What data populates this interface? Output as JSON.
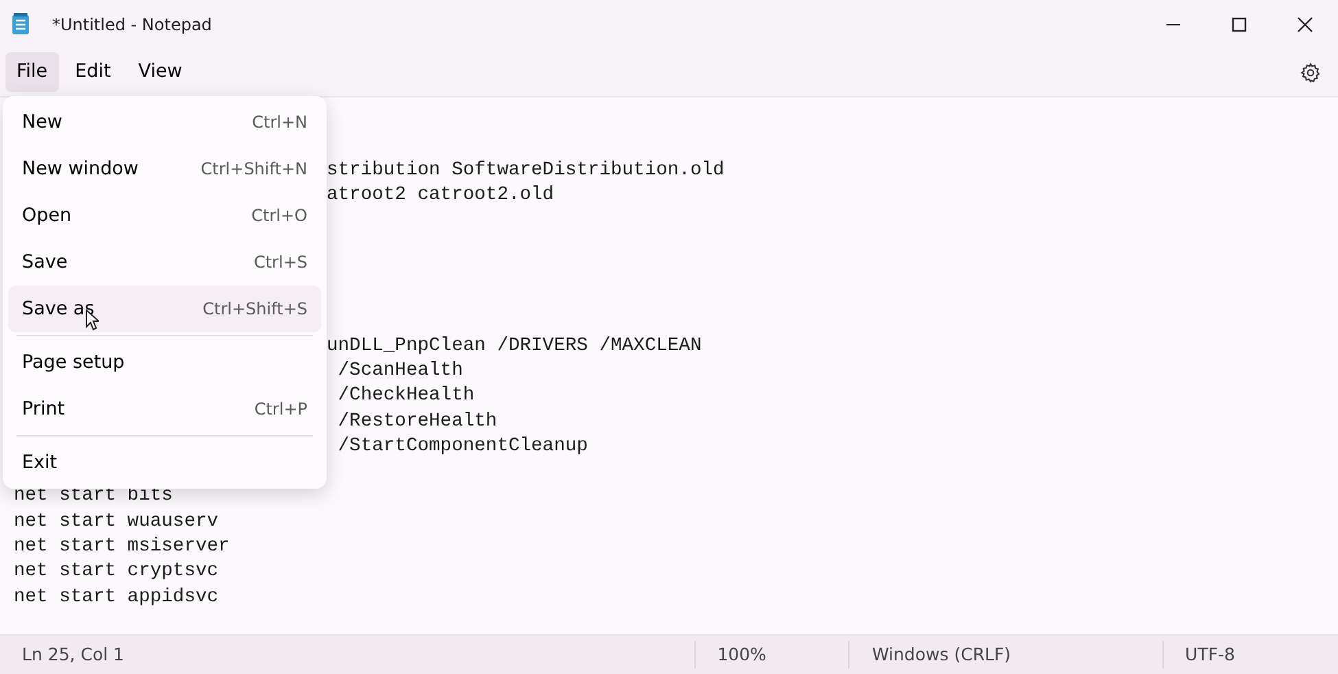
{
  "window": {
    "title": "*Untitled - Notepad"
  },
  "menu_bar": [
    {
      "label": "File",
      "selected": true
    },
    {
      "label": "Edit",
      "selected": false
    },
    {
      "label": "View",
      "selected": false
    }
  ],
  "file_menu": [
    {
      "items": [
        {
          "label": "New",
          "shortcut": "Ctrl+N",
          "hovered": false
        },
        {
          "label": "New window",
          "shortcut": "Ctrl+Shift+N",
          "hovered": false
        },
        {
          "label": "Open",
          "shortcut": "Ctrl+O",
          "hovered": false
        },
        {
          "label": "Save",
          "shortcut": "Ctrl+S",
          "hovered": false
        },
        {
          "label": "Save as",
          "shortcut": "Ctrl+Shift+S",
          "hovered": true
        }
      ]
    },
    {
      "items": [
        {
          "label": "Page setup",
          "hovered": false
        },
        {
          "label": "Print",
          "shortcut": "Ctrl+P",
          "hovered": false
        }
      ]
    },
    {
      "items": [
        {
          "label": "Exit",
          "hovered": false
        }
      ]
    }
  ],
  "editor_blocks_beside_menu": [
    {
      "lines": [
        "stribution SoftwareDistribution.old",
        "atroot2 catroot2.old"
      ]
    },
    {
      "lines": [
        "unDLL_PnpClean /DRIVERS /MAXCLEAN",
        " /ScanHealth",
        " /CheckHealth",
        " /RestoreHealth",
        " /StartComponentCleanup"
      ]
    }
  ],
  "editor_lines": [
    "net start bits",
    "net start wuauserv",
    "net start msiserver",
    "net start cryptsvc",
    "net start appidsvc"
  ],
  "status_bar": {
    "position": "Ln 25, Col 1",
    "zoom": "100%",
    "line_ending": "Windows (CRLF)",
    "encoding": "UTF-8"
  }
}
